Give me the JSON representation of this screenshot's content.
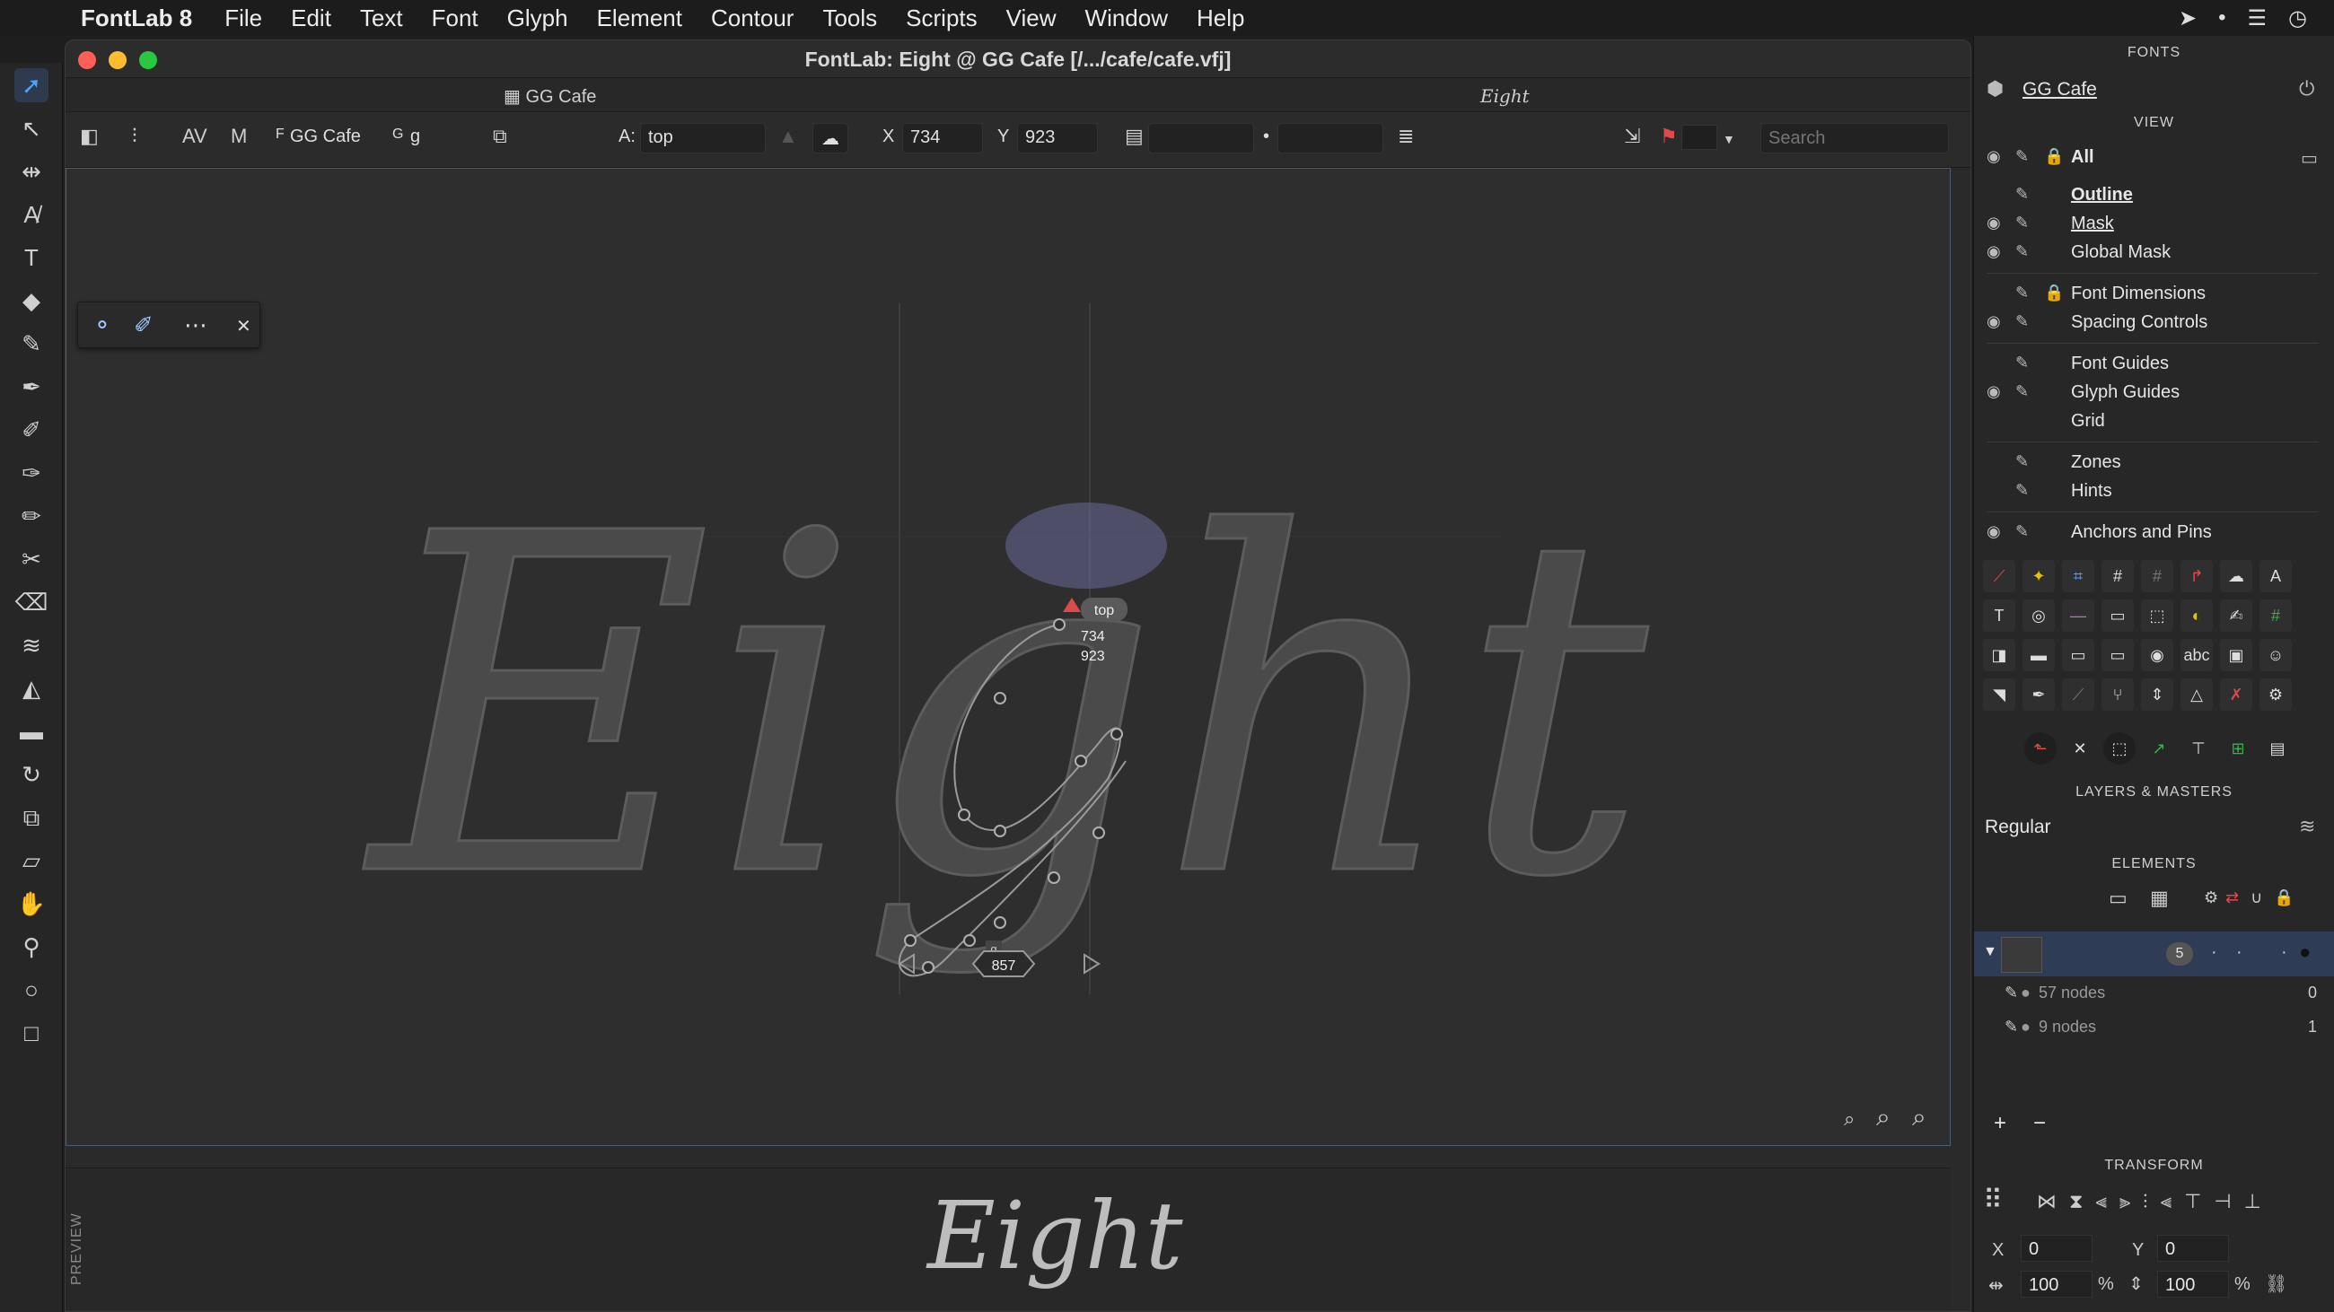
{
  "menubar": {
    "app_name": "FontLab 8",
    "items": [
      "File",
      "Edit",
      "Text",
      "Font",
      "Glyph",
      "Element",
      "Contour",
      "Tools",
      "Scripts",
      "View",
      "Window",
      "Help"
    ]
  },
  "window": {
    "title": "FontLab: Eight @ GG Cafe  [/.../cafe/cafe.vfj]",
    "tabs": {
      "font_tab": "GG Cafe",
      "glyph_tab": "Eight"
    }
  },
  "props": {
    "font_label": "F",
    "font_name": "GG Cafe",
    "glyph_label": "G",
    "glyph_name": "g",
    "anchor_label": "A:",
    "anchor_value": "top",
    "x_label": "X",
    "x_value": "734",
    "y_label": "Y",
    "y_value": "923",
    "search_placeholder": "Search"
  },
  "canvas": {
    "glyph_text": "Eight",
    "anchor_tag": "top",
    "coord_x": "734",
    "coord_y": "923",
    "glyph_tag": "g",
    "advance_width": "857"
  },
  "preview": {
    "label": "PREVIEW",
    "text": "Eight"
  },
  "panel": {
    "fonts_header": "FONTS",
    "font_name": "GG Cafe",
    "view_header": "VIEW",
    "view_items": [
      "All",
      "Outline",
      "Mask",
      "Global Mask",
      "Font Dimensions",
      "Spacing Controls",
      "Font Guides",
      "Glyph Guides",
      "Grid",
      "Zones",
      "Hints",
      "Anchors and Pins"
    ],
    "layers_header": "LAYERS & MASTERS",
    "layer_name": "Regular",
    "elements_header": "ELEMENTS",
    "element_count": "5",
    "nodes": [
      {
        "label": "57 nodes",
        "index": "0"
      },
      {
        "label": "9 nodes",
        "index": "1"
      }
    ],
    "add_label": "+",
    "remove_label": "−",
    "transform_header": "TRANSFORM",
    "transform": {
      "x_label": "X",
      "x_value": "0",
      "y_label": "Y",
      "y_value": "0",
      "w_value": "100",
      "h_value": "100",
      "pct": "%"
    }
  },
  "colors": {
    "accent": "#4da3ff",
    "anchor_red": "#e0494a",
    "canvas_bg": "#2e2e2e",
    "glyph_fill": "#4a4a4a"
  }
}
